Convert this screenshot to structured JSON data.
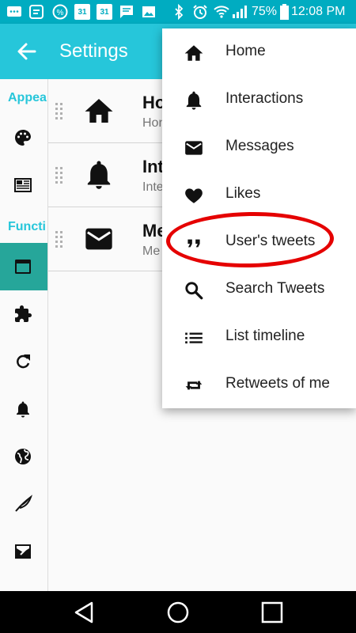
{
  "status_bar": {
    "battery": "75%",
    "time": "12:08 PM",
    "calendar_day_1": "31",
    "calendar_day_2": "31",
    "icons": [
      "message-icon",
      "percent-icon",
      "calendar-icon",
      "calendar-icon",
      "chat-icon",
      "image-icon",
      "bluetooth-icon",
      "alarm-icon",
      "wifi-icon",
      "signal-icon",
      "battery-icon"
    ]
  },
  "app_bar": {
    "title": "Settings"
  },
  "rail": {
    "appearance_header": "Appea",
    "functions_header": "Functi",
    "items": [
      {
        "icon": "palette-icon"
      },
      {
        "icon": "newspaper-icon"
      },
      {
        "icon": "tab-icon",
        "selected": true
      },
      {
        "icon": "puzzle-icon"
      },
      {
        "icon": "refresh-icon"
      },
      {
        "icon": "bell-icon"
      },
      {
        "icon": "globe-icon"
      },
      {
        "icon": "feather-icon"
      },
      {
        "icon": "compose-icon"
      }
    ]
  },
  "list": {
    "rows": [
      {
        "title": "Ho",
        "subtitle": "Hon",
        "icon": "home-icon"
      },
      {
        "title": "Int",
        "subtitle": "Inte",
        "icon": "bell-icon"
      },
      {
        "title": "Me",
        "subtitle": "Me",
        "icon": "mail-icon"
      }
    ]
  },
  "menu": {
    "items": [
      {
        "label": "Home",
        "icon": "home-icon"
      },
      {
        "label": "Interactions",
        "icon": "bell-icon"
      },
      {
        "label": "Messages",
        "icon": "mail-icon"
      },
      {
        "label": "Likes",
        "icon": "heart-icon"
      },
      {
        "label": "User's tweets",
        "icon": "quote-icon",
        "highlighted": true
      },
      {
        "label": "Search Tweets",
        "icon": "search-icon"
      },
      {
        "label": "List timeline",
        "icon": "list-icon"
      },
      {
        "label": "Retweets of me",
        "icon": "retweet-icon"
      }
    ]
  },
  "colors": {
    "status_bar": "#00acc1",
    "app_bar": "#26c6da",
    "accent": "#26c6da",
    "selected_rail": "#26a69a",
    "highlight_ring": "#e50000"
  }
}
